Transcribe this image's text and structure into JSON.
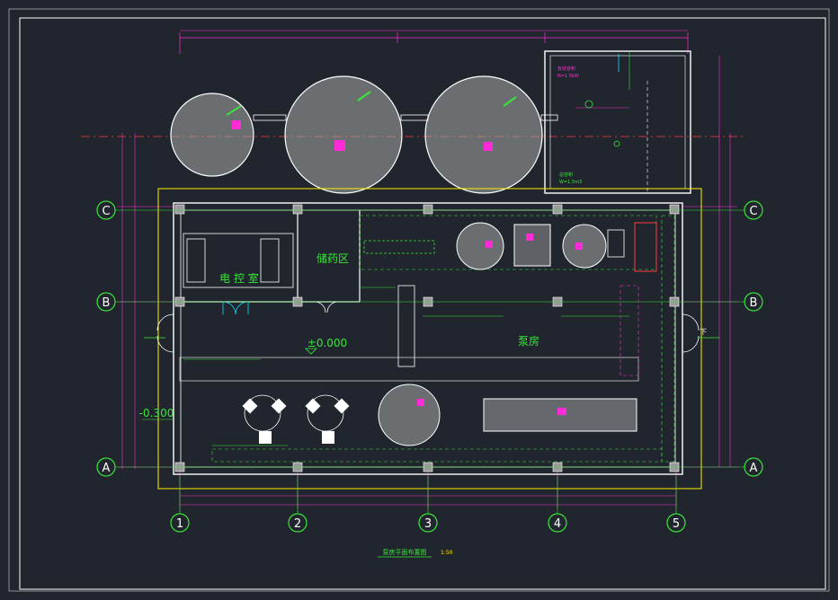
{
  "colors": {
    "background": "#21262e",
    "wall": "#ffffff",
    "column": "#9a9a9a",
    "dimension": "#ff2bd6",
    "annotation": "#39e639",
    "center_line": "#ff3b3b",
    "yellow": "#ffee00",
    "grid_bubble": "#39e639"
  },
  "axes": {
    "columns": [
      "1",
      "2",
      "3",
      "4",
      "5"
    ],
    "rows": [
      "C",
      "B",
      "A"
    ]
  },
  "rooms": {
    "electrical_room": "电 控 室",
    "storage_room": "储药区",
    "pump_room": "泵房"
  },
  "levels": {
    "floor": "±0.000",
    "outside": "-0.300"
  },
  "drawing_title": "泵房平面布置图",
  "scale": "1:50",
  "legend_box": {
    "tank_line1": "有效容积",
    "tank_line2": "N=1.5kW",
    "tank_line3": "总容积",
    "tank_line4": "W=1.5m3"
  },
  "stair": "下"
}
